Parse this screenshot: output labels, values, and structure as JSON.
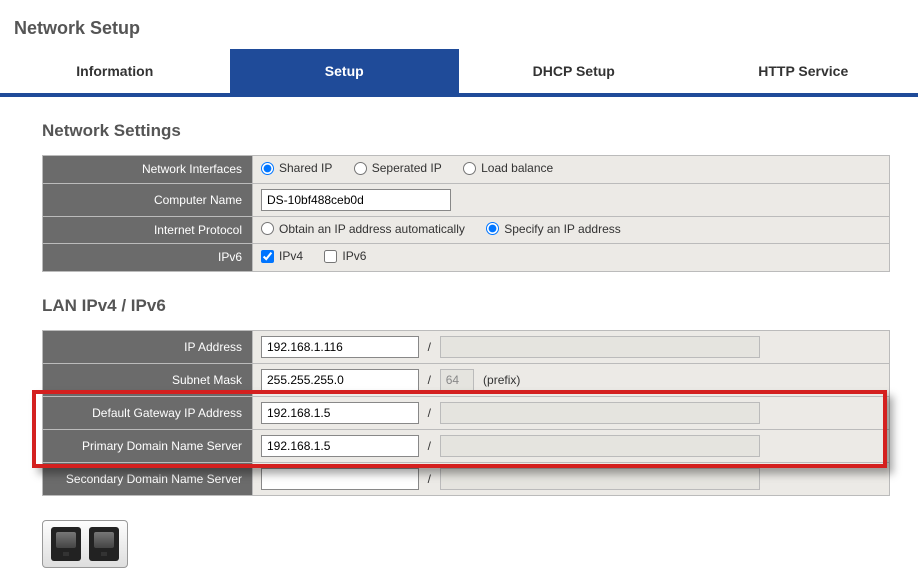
{
  "page": {
    "title": "Network Setup"
  },
  "tabs": {
    "information": "Information",
    "setup": "Setup",
    "dhcp": "DHCP Setup",
    "http": "HTTP Service",
    "active": "setup"
  },
  "network_settings": {
    "title": "Network Settings",
    "labels": {
      "interfaces": "Network Interfaces",
      "computer_name": "Computer Name",
      "internet_protocol": "Internet Protocol",
      "ipv6": "IPv6"
    },
    "network_interfaces_options": {
      "shared": "Shared IP",
      "separated": "Seperated IP",
      "load_balance": "Load balance",
      "selected": "shared"
    },
    "computer_name": "DS-10bf488ceb0d",
    "internet_protocol_options": {
      "obtain": "Obtain an IP address automatically",
      "specify": "Specify an IP address",
      "selected": "specify"
    },
    "ipv6_options": {
      "ipv4_label": "IPv4",
      "ipv6_label": "IPv6",
      "ipv4_checked": true,
      "ipv6_checked": false
    }
  },
  "lan": {
    "title": "LAN IPv4 / IPv6",
    "labels": {
      "ip": "IP Address",
      "subnet": "Subnet Mask",
      "gateway": "Default Gateway IP Address",
      "primary_dns": "Primary Domain Name Server",
      "secondary_dns": "Secondary Domain Name Server"
    },
    "ip_v4": "192.168.1.116",
    "ip_v6": "",
    "subnet_v4": "255.255.255.0",
    "subnet_prefix": "64",
    "prefix_suffix": "(prefix)",
    "gateway_v4": "192.168.1.5",
    "gateway_v6": "",
    "primary_dns_v4": "192.168.1.5",
    "primary_dns_v6": "",
    "secondary_dns_v4": "",
    "secondary_dns_v6": ""
  }
}
